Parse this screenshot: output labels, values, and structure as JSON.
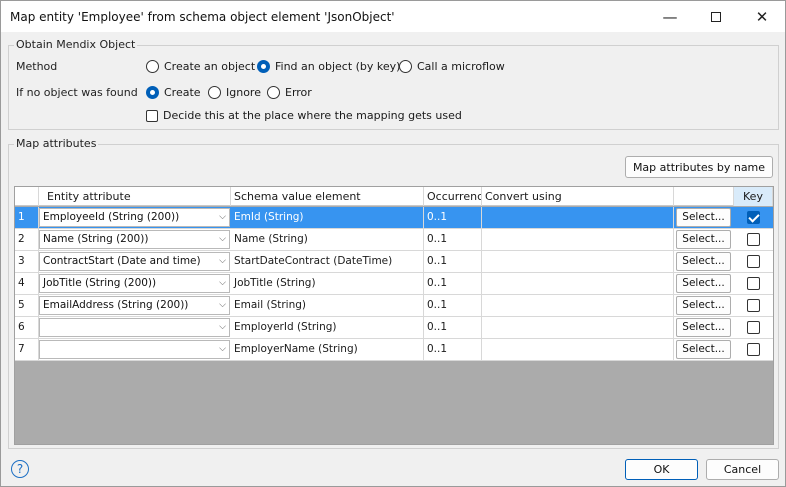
{
  "window": {
    "title": "Map entity 'Employee' from schema object element 'JsonObject'"
  },
  "obtain": {
    "group_label": "Obtain Mendix Object",
    "method_label": "Method",
    "method_options": [
      "Create an object",
      "Find an object (by key)",
      "Call a microflow"
    ],
    "method_selected": "Find an object (by key)",
    "notfound_label": "If no object was found",
    "notfound_options": [
      "Create",
      "Ignore",
      "Error"
    ],
    "notfound_selected": "Create",
    "decide_label": "Decide this at the place where the mapping gets used",
    "decide_checked": false
  },
  "map": {
    "group_label": "Map attributes",
    "map_by_name_label": "Map attributes by name",
    "columns": [
      "Entity attribute",
      "Schema value element",
      "Occurrence",
      "Convert using",
      "Key"
    ],
    "select_label": "Select...",
    "rows": [
      {
        "num": "1",
        "attr": "EmployeeId (String (200))",
        "schema": "EmId (String)",
        "occ": "0..1",
        "key": true,
        "selected": true
      },
      {
        "num": "2",
        "attr": "Name (String (200))",
        "schema": "Name (String)",
        "occ": "0..1",
        "key": false
      },
      {
        "num": "3",
        "attr": "ContractStart (Date and time)",
        "schema": "StartDateContract (DateTime)",
        "occ": "0..1",
        "key": false
      },
      {
        "num": "4",
        "attr": "JobTitle (String (200))",
        "schema": "JobTitle (String)",
        "occ": "0..1",
        "key": false
      },
      {
        "num": "5",
        "attr": "EmailAddress (String (200))",
        "schema": "Email (String)",
        "occ": "0..1",
        "key": false
      },
      {
        "num": "6",
        "attr": "",
        "schema": "EmployerId (String)",
        "occ": "0..1",
        "key": false
      },
      {
        "num": "7",
        "attr": "",
        "schema": "EmployerName (String)",
        "occ": "0..1",
        "key": false
      }
    ]
  },
  "footer": {
    "ok_label": "OK",
    "cancel_label": "Cancel",
    "help_glyph": "?"
  },
  "colors": {
    "accent": "#005fb8",
    "selected_row": "#3794f0",
    "grid_empty": "#ababab"
  }
}
